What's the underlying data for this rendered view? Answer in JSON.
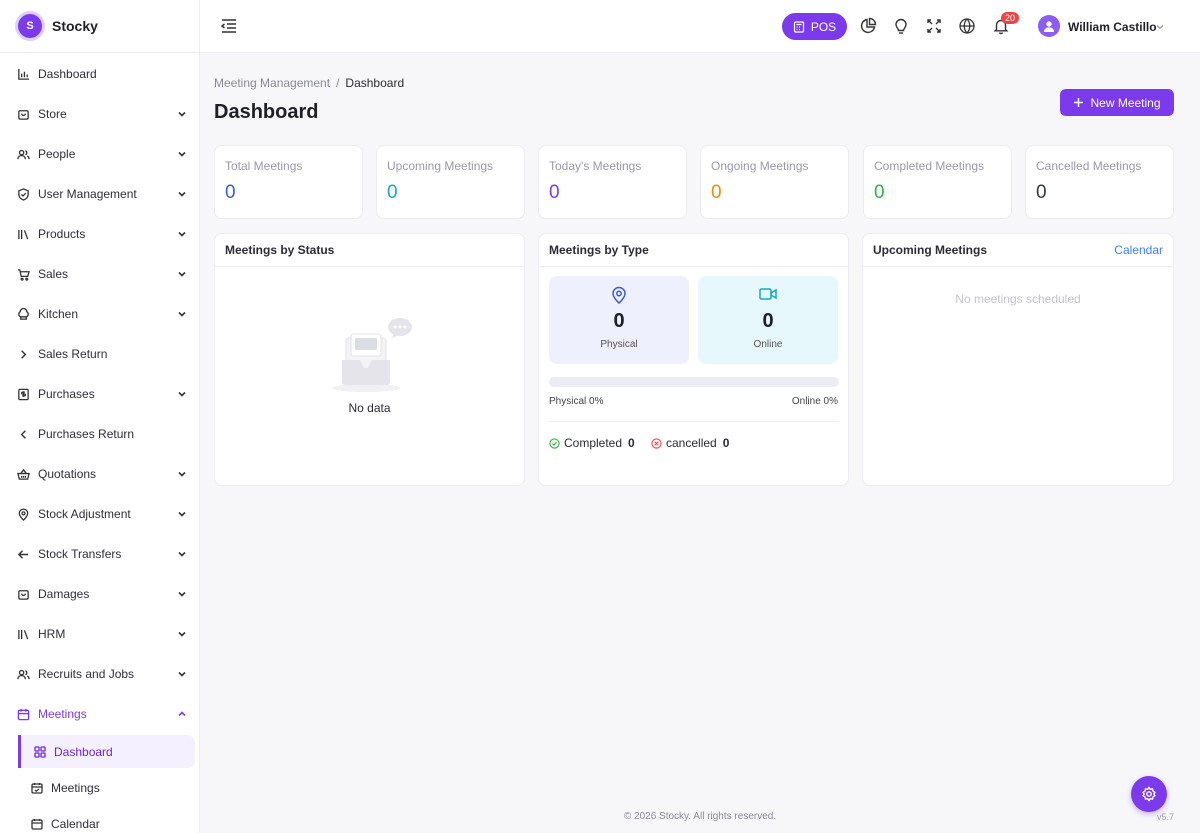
{
  "brand": {
    "logo_letter": "S",
    "name": "Stocky"
  },
  "sidebar": {
    "items": [
      {
        "label": "Dashboard",
        "icon": "bar-chart-icon",
        "expandable": false
      },
      {
        "label": "Store",
        "icon": "shopping-bag-icon",
        "expandable": true
      },
      {
        "label": "People",
        "icon": "users-icon",
        "expandable": true
      },
      {
        "label": "User Management",
        "icon": "shield-check-icon",
        "expandable": true
      },
      {
        "label": "Products",
        "icon": "library-icon",
        "expandable": true
      },
      {
        "label": "Sales",
        "icon": "cart-icon",
        "expandable": true
      },
      {
        "label": "Kitchen",
        "icon": "chef-hat-icon",
        "expandable": true
      },
      {
        "label": "Sales Return",
        "icon": "chevron-right-icon",
        "expandable": false
      },
      {
        "label": "Purchases",
        "icon": "receipt-icon",
        "expandable": true
      },
      {
        "label": "Purchases Return",
        "icon": "chevron-left-icon",
        "expandable": false
      },
      {
        "label": "Quotations",
        "icon": "basket-icon",
        "expandable": true
      },
      {
        "label": "Stock Adjustment",
        "icon": "map-pin-icon",
        "expandable": true
      },
      {
        "label": "Stock Transfers",
        "icon": "arrow-left-icon",
        "expandable": true
      },
      {
        "label": "Damages",
        "icon": "shopping-bag-icon",
        "expandable": true
      },
      {
        "label": "HRM",
        "icon": "library-icon",
        "expandable": true
      },
      {
        "label": "Recruits and Jobs",
        "icon": "users-icon",
        "expandable": true
      },
      {
        "label": "Meetings",
        "icon": "calendar-icon",
        "expandable": true
      }
    ],
    "meetings_sub": [
      {
        "label": "Dashboard",
        "icon": "grid-icon"
      },
      {
        "label": "Meetings",
        "icon": "calendar-check-icon"
      },
      {
        "label": "Calendar",
        "icon": "calendar-icon"
      }
    ]
  },
  "topbar": {
    "pos_label": "POS",
    "notification_count": "20",
    "user_name": "William Castillo"
  },
  "breadcrumb": {
    "parent": "Meeting Management",
    "current": "Dashboard"
  },
  "page": {
    "title": "Dashboard",
    "new_button": "New Meeting"
  },
  "stats": [
    {
      "label": "Total Meetings",
      "value": "0",
      "color": "#3b5bdb"
    },
    {
      "label": "Upcoming Meetings",
      "value": "0",
      "color": "#15aabf"
    },
    {
      "label": "Today's Meetings",
      "value": "0",
      "color": "#7c3aed"
    },
    {
      "label": "Ongoing Meetings",
      "value": "0",
      "color": "#f08c00"
    },
    {
      "label": "Completed Meetings",
      "value": "0",
      "color": "#2fb344"
    },
    {
      "label": "Cancelled Meetings",
      "value": "0",
      "color": "#343a40"
    }
  ],
  "status_card": {
    "title": "Meetings by Status",
    "empty": "No data"
  },
  "type_card": {
    "title": "Meetings by Type",
    "physical": {
      "count": "0",
      "label": "Physical",
      "color": "#eef0fd"
    },
    "online": {
      "count": "0",
      "label": "Online",
      "color": "#e6f8fb"
    },
    "physical_pct_label": "Physical 0%",
    "online_pct_label": "Online 0%",
    "physical_fraction": 0,
    "completed_label": "Completed",
    "completed_count": "0",
    "cancelled_label": "cancelled",
    "cancelled_count": "0"
  },
  "upcoming_card": {
    "title": "Upcoming Meetings",
    "link": "Calendar",
    "empty": "No meetings scheduled"
  },
  "footer": {
    "copyright": "© 2026 Stocky. All rights reserved.",
    "version": "v5.7"
  },
  "colors": {
    "accent": "#7c3aed",
    "link": "#3b82f6",
    "danger": "#ef4444"
  }
}
